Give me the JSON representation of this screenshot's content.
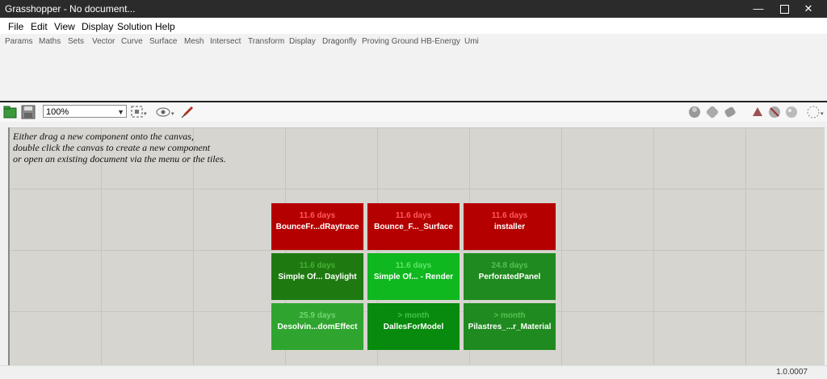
{
  "window": {
    "title": "Grasshopper - No document..."
  },
  "menu": [
    "File",
    "Edit",
    "View",
    "Display",
    "Solution",
    "Help"
  ],
  "tabs": [
    "Params",
    "Maths",
    "Sets",
    "Vector",
    "Curve",
    "Surface",
    "Mesh",
    "Intersect",
    "Transform",
    "Display",
    "Dragonfly",
    "Proving Ground",
    "HB-Energy",
    "Umi"
  ],
  "toolbar": {
    "zoom": "100%"
  },
  "canvas": {
    "hint": [
      "Either drag a new component onto the canvas,",
      "double click the canvas to create a new component",
      "or open an existing document via the menu or the tiles."
    ]
  },
  "tiles": [
    {
      "age": "11.6 days",
      "name": "BounceFr...dRaytrace",
      "status": "red"
    },
    {
      "age": "11.6 days",
      "name": "Bounce_F..._Surface",
      "status": "red"
    },
    {
      "age": "11.6 days",
      "name": "installer",
      "status": "red"
    },
    {
      "age": "11.6 days",
      "name": "Simple Of... Daylight",
      "status": "green-dark"
    },
    {
      "age": "11.6 days",
      "name": "Simple Of... - Render",
      "status": "green-bright"
    },
    {
      "age": "24.8 days",
      "name": "PerforatedPanel",
      "status": "green"
    },
    {
      "age": "25.9 days",
      "name": "Desolvin...domEffect",
      "status": "green-light"
    },
    {
      "age": "> month",
      "name": "DallesForModel",
      "status": "green-deep"
    },
    {
      "age": "> month",
      "name": "Pilastres_...r_Material",
      "status": "green"
    }
  ],
  "colors": {
    "red": {
      "bg": "#b50000",
      "age": "#ff5a5a"
    },
    "green-dark": {
      "bg": "#1e7a10",
      "age": "#45b035"
    },
    "green-bright": {
      "bg": "#0fb81f",
      "age": "#5fe56a"
    },
    "green": {
      "bg": "#1f8a1f",
      "age": "#53c253"
    },
    "green-light": {
      "bg": "#2fa52f",
      "age": "#6fd66f"
    },
    "green-deep": {
      "bg": "#078a0d",
      "age": "#3fc545"
    }
  },
  "status": {
    "version": "1.0.0007"
  }
}
